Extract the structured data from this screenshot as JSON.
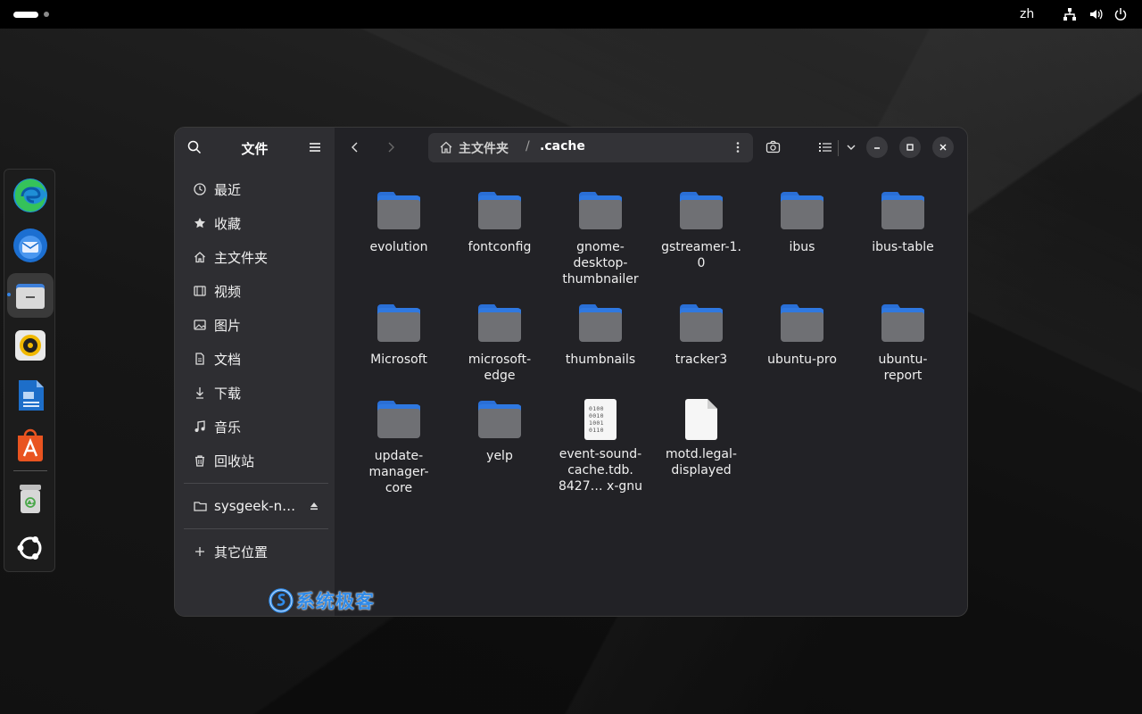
{
  "topbar": {
    "language": "zh",
    "icons": [
      "network-icon",
      "volume-icon",
      "power-icon"
    ]
  },
  "dock": {
    "apps": [
      {
        "name": "Microsoft Edge",
        "icon": "edge-icon"
      },
      {
        "name": "Thunderbird",
        "icon": "thunderbird-icon"
      },
      {
        "name": "Files",
        "icon": "files-icon",
        "active": true
      },
      {
        "name": "Rhythmbox",
        "icon": "rhythmbox-icon"
      },
      {
        "name": "LibreOffice Writer",
        "icon": "writer-icon"
      },
      {
        "name": "App Center",
        "icon": "app-center-icon"
      },
      {
        "name": "Trash",
        "icon": "trash-icon"
      },
      {
        "name": "Show Apps",
        "icon": "ubuntu-icon"
      }
    ]
  },
  "window": {
    "sidebar": {
      "title": "文件",
      "places": [
        {
          "label": "最近",
          "icon": "clock-icon"
        },
        {
          "label": "收藏",
          "icon": "star-icon"
        },
        {
          "label": "主文件夹",
          "icon": "home-icon"
        },
        {
          "label": "视频",
          "icon": "video-icon"
        },
        {
          "label": "图片",
          "icon": "image-icon"
        },
        {
          "label": "文档",
          "icon": "document-icon"
        },
        {
          "label": "下载",
          "icon": "download-icon"
        },
        {
          "label": "音乐",
          "icon": "music-icon"
        },
        {
          "label": "回收站",
          "icon": "trash-icon"
        }
      ],
      "drive": {
        "label": "sysgeek-n…",
        "icon": "folder-icon"
      },
      "other_locations": {
        "label": "其它位置",
        "icon": "plus-icon"
      }
    },
    "path": {
      "home": "主文件夹",
      "separator": "/",
      "current": ".cache"
    },
    "items": [
      {
        "label": "evolution",
        "type": "folder"
      },
      {
        "label": "fontconfig",
        "type": "folder"
      },
      {
        "label": "gnome-desktop-thumbnailer",
        "type": "folder",
        "lines": [
          "gnome-",
          "desktop-",
          "thumbnailer"
        ]
      },
      {
        "label": "gstreamer-1.0",
        "type": "folder",
        "lines": [
          "gstreamer-1.",
          "0"
        ]
      },
      {
        "label": "ibus",
        "type": "folder"
      },
      {
        "label": "ibus-table",
        "type": "folder"
      },
      {
        "label": "Microsoft",
        "type": "folder"
      },
      {
        "label": "microsoft-edge",
        "type": "folder",
        "lines": [
          "microsoft-",
          "edge"
        ]
      },
      {
        "label": "thumbnails",
        "type": "folder"
      },
      {
        "label": "tracker3",
        "type": "folder"
      },
      {
        "label": "ubuntu-pro",
        "type": "folder"
      },
      {
        "label": "ubuntu-report",
        "type": "folder",
        "lines": [
          "ubuntu-",
          "report"
        ]
      },
      {
        "label": "update-manager-core",
        "type": "folder",
        "lines": [
          "update-",
          "manager-",
          "core"
        ]
      },
      {
        "label": "yelp",
        "type": "folder"
      },
      {
        "label": "event-sound-cache.tdb.8427…x-gnu",
        "type": "binary",
        "lines": [
          "event-sound-",
          "cache.tdb.",
          "8427… x-gnu"
        ]
      },
      {
        "label": "motd.legal-displayed",
        "type": "text",
        "lines": [
          "motd.legal-",
          "displayed"
        ]
      }
    ],
    "binary_glyph": [
      "0100",
      "0010",
      "1001",
      "0110"
    ]
  },
  "watermark": {
    "text": "系统极客"
  },
  "colors": {
    "accent": "#3584e4",
    "folder_blue": "#2f78e0",
    "folder_grey": "#6f7074"
  }
}
